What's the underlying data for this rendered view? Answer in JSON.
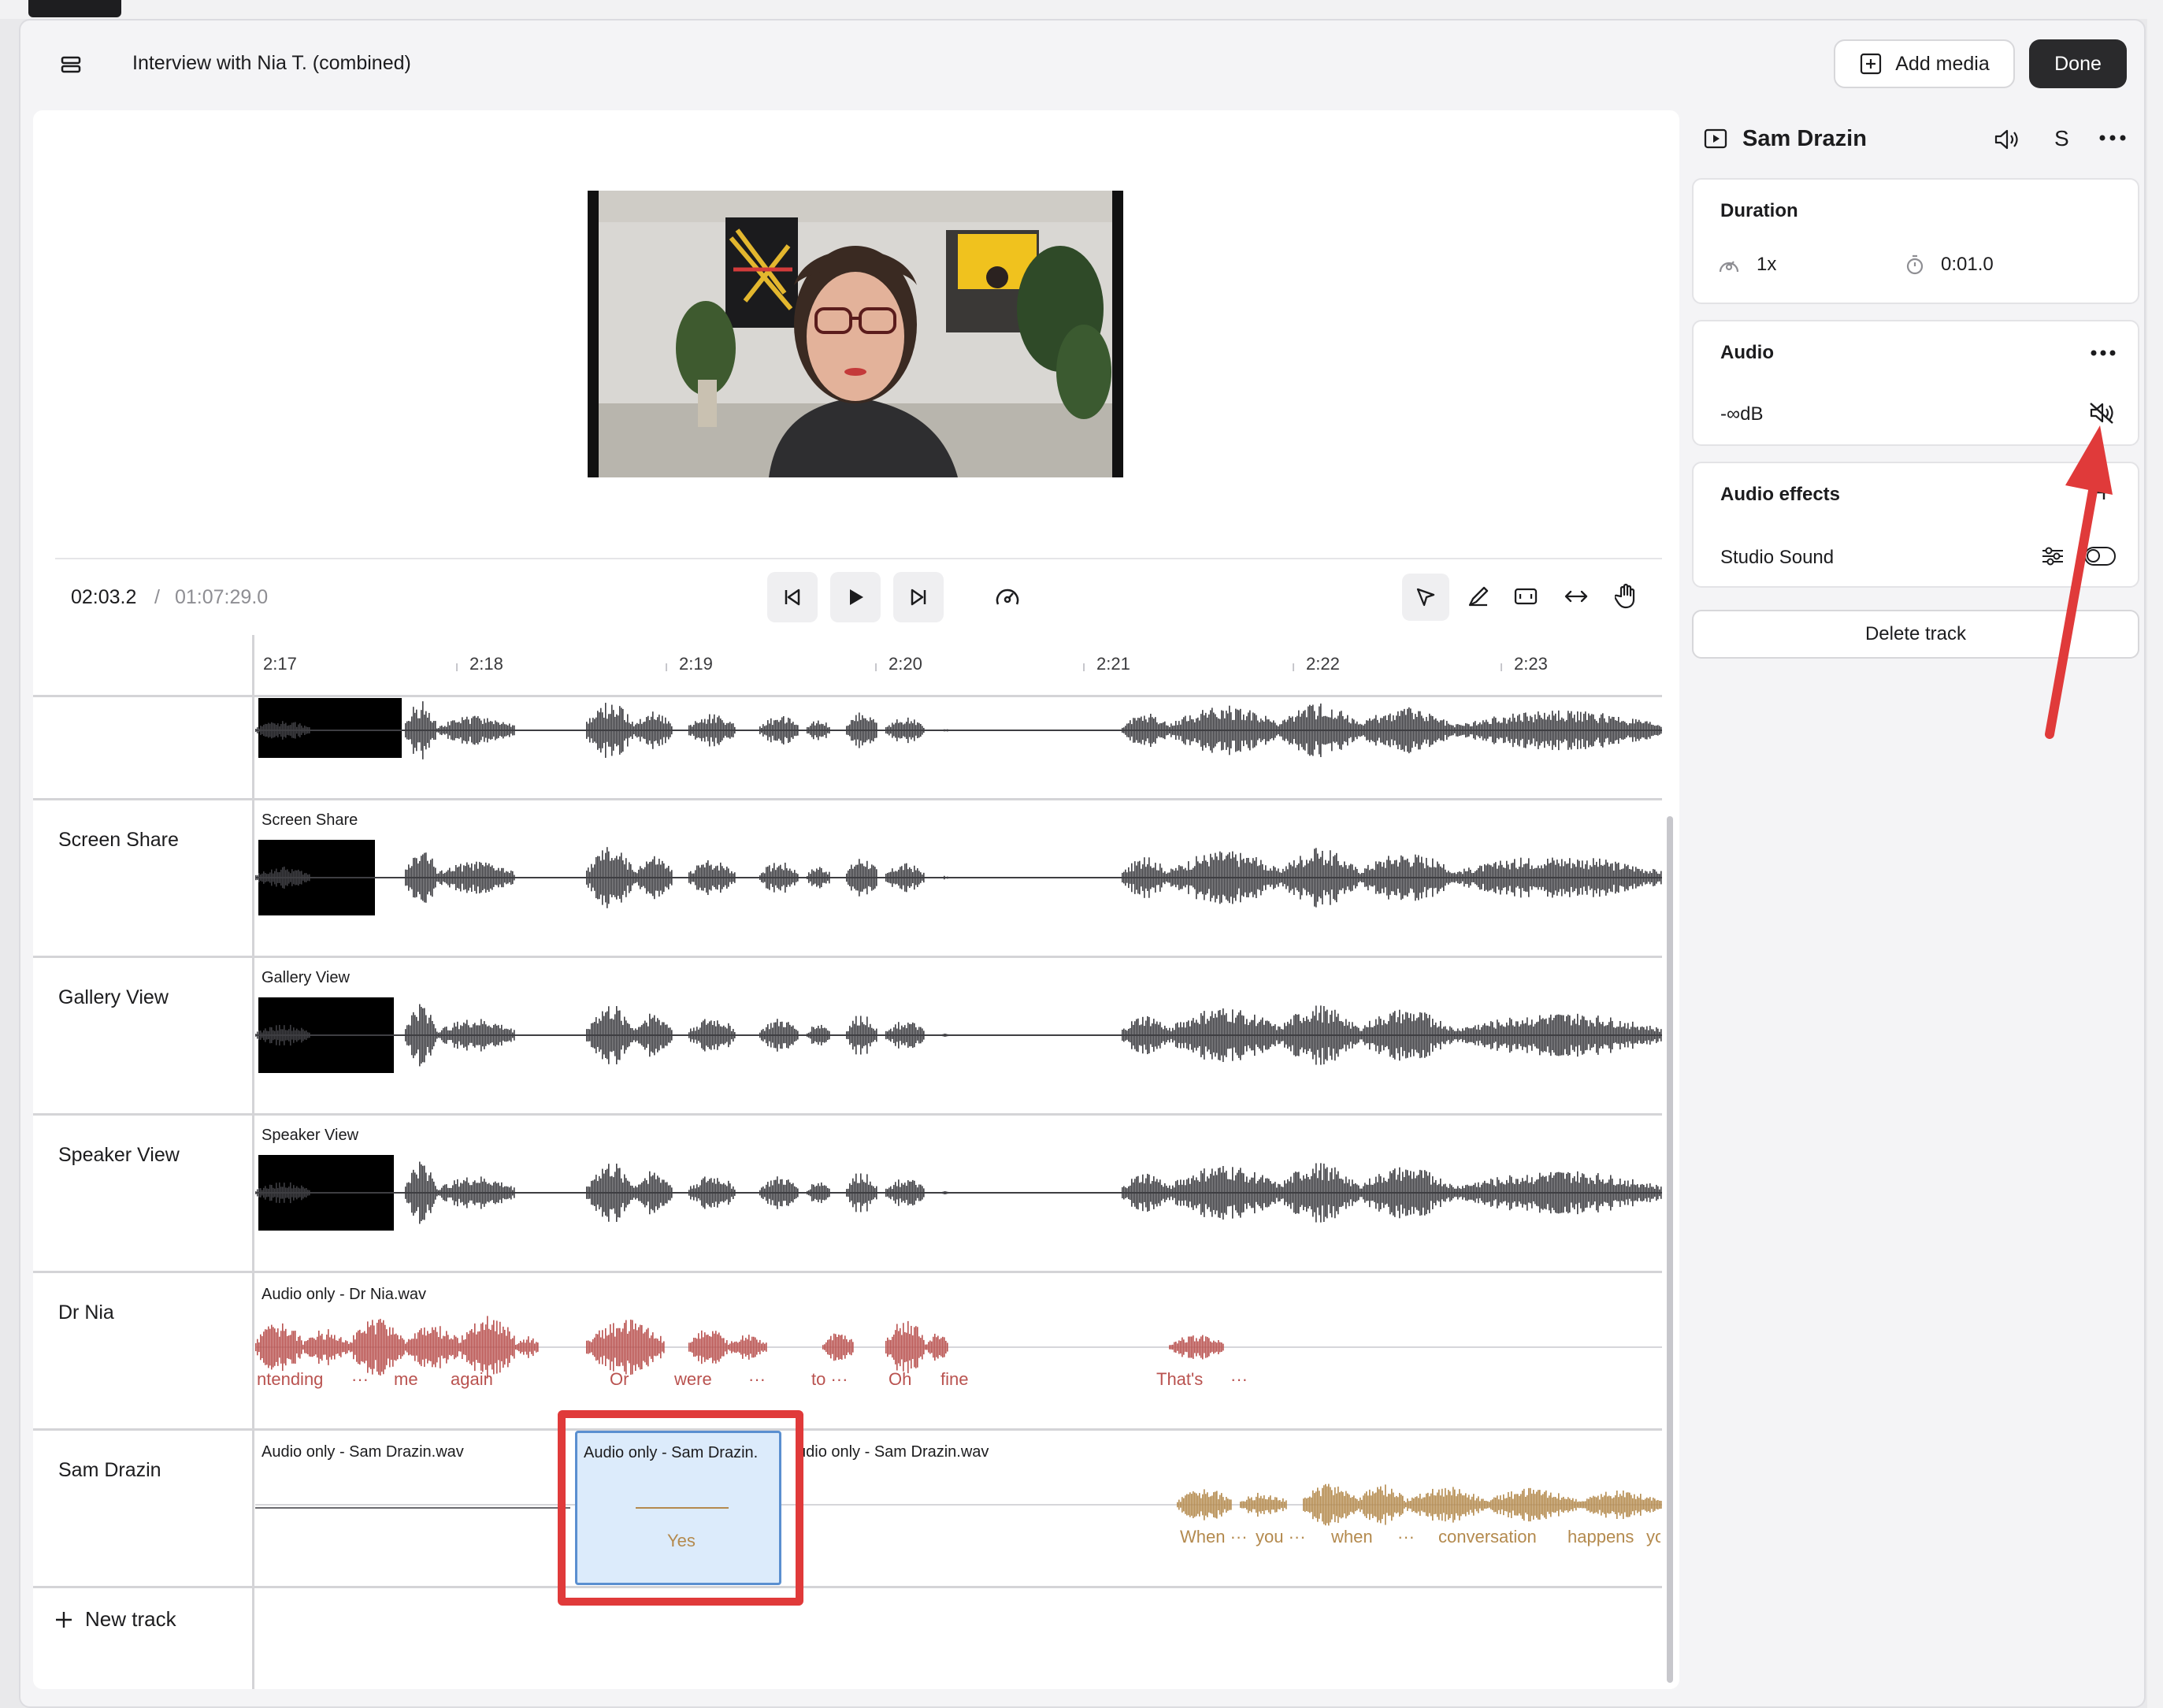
{
  "header": {
    "title": "Interview with Nia T. (combined)",
    "add_media": "Add media",
    "done": "Done"
  },
  "transport": {
    "current_time": "02:03.2",
    "separator": "/",
    "total_time": "01:07:29.0"
  },
  "ruler": {
    "ticks": [
      "2:17",
      "2:18",
      "2:19",
      "2:20",
      "2:21",
      "2:22",
      "2:23"
    ]
  },
  "tracks": [
    {
      "name": "",
      "clip": ""
    },
    {
      "name": "Screen Share",
      "clip": "Screen Share"
    },
    {
      "name": "Gallery View",
      "clip": "Gallery View"
    },
    {
      "name": "Speaker View",
      "clip": "Speaker View"
    },
    {
      "name": "Dr Nia",
      "clip": "Audio only - Dr Nia.wav"
    },
    {
      "name": "Sam Drazin",
      "clip": "Audio only - Sam Drazin.wav"
    }
  ],
  "sam_clips": {
    "first": "Audio only - Sam Drazin.wav",
    "selected": "Audio only - Sam Drazin. ",
    "third": "udio only - Sam Drazin.wav"
  },
  "nia_words": [
    "ntending",
    "···",
    "me",
    "again",
    "Or",
    "were",
    "···",
    "to ···",
    "Oh",
    "fine",
    "That's",
    "···"
  ],
  "sam_words": [
    "Yes",
    "When ···",
    "you ···",
    "when",
    "···",
    "conversation",
    "happens",
    "yo"
  ],
  "new_track": "New track",
  "inspector": {
    "track_title": "Sam Drazin",
    "solo": "S",
    "duration": {
      "title": "Duration",
      "speed": "1x",
      "time": "0:01.0"
    },
    "audio": {
      "title": "Audio",
      "level": "-∞dB"
    },
    "effects": {
      "title": "Audio effects",
      "studio_sound": "Studio Sound"
    },
    "delete": "Delete track"
  },
  "colors": {
    "accent_red": "#e03a3a",
    "nia_wave": "#b9524f",
    "sam_wave": "#b48a4e",
    "selection_fill": "#dcebfb",
    "selection_border": "#5a8fd0"
  }
}
